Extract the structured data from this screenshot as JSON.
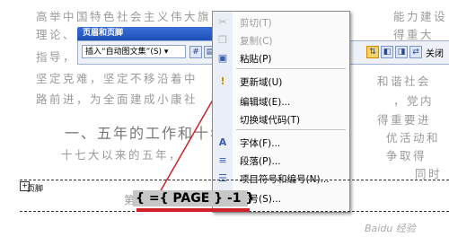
{
  "document": {
    "lines": [
      {
        "left": "高举中国特色社会主义伟大旗",
        "right": "能力建设"
      },
      {
        "left": "理论、",
        "right": "得重大"
      },
      {
        "left": "指导，",
        "right": "和谐社会"
      },
      {
        "left": "坚定克难，坚定不移沿着中",
        "right": "，党内"
      },
      {
        "left": "路前进，为全面建成小康社",
        "right": "得重要进"
      }
    ],
    "right_more": [
      "优活动和",
      "争取得"
    ],
    "heading": "一、五年的工作和十年",
    "sub_line": "十七大以来的五年，",
    "right_last": "同时"
  },
  "toolbar": {
    "title": "页眉和页脚",
    "insert_label": "插入“自动图文集”(S) ▾",
    "close_label": "关闭"
  },
  "context_menu": {
    "items": [
      {
        "label": "剪切(T)",
        "icon": "scissors-icon",
        "glyph": "✂",
        "disabled": true
      },
      {
        "label": "复制(C)",
        "icon": "copy-icon",
        "glyph": "❐",
        "disabled": true
      },
      {
        "label": "粘贴(P)",
        "icon": "paste-icon",
        "glyph": "📋",
        "disabled": false
      },
      {
        "label": "更新域(U)",
        "icon": "update-field-icon",
        "glyph": "!",
        "disabled": false
      },
      {
        "label": "编辑域(E)...",
        "icon": "",
        "glyph": "",
        "disabled": false
      },
      {
        "label": "切换域代码(T)",
        "icon": "",
        "glyph": "",
        "disabled": false
      },
      {
        "label": "字体(F)...",
        "icon": "font-icon",
        "glyph": "A",
        "disabled": false
      },
      {
        "label": "段落(P)...",
        "icon": "paragraph-icon",
        "glyph": "≡",
        "disabled": false
      },
      {
        "label": "项目符号和编号(N)...",
        "icon": "bullets-icon",
        "glyph": "☰",
        "disabled": false
      },
      {
        "label": "符号(S)...",
        "icon": "",
        "glyph": "",
        "disabled": false
      }
    ]
  },
  "footer": {
    "label": "页脚",
    "prefix": "第",
    "field_code": "{ ={ PAGE } -1 }"
  },
  "watermark": "Baidu 经验",
  "colors": {
    "highlight": "#d0202a",
    "toolbar_title": "#1d4fb8",
    "field_bg": "#c7c7c7"
  }
}
